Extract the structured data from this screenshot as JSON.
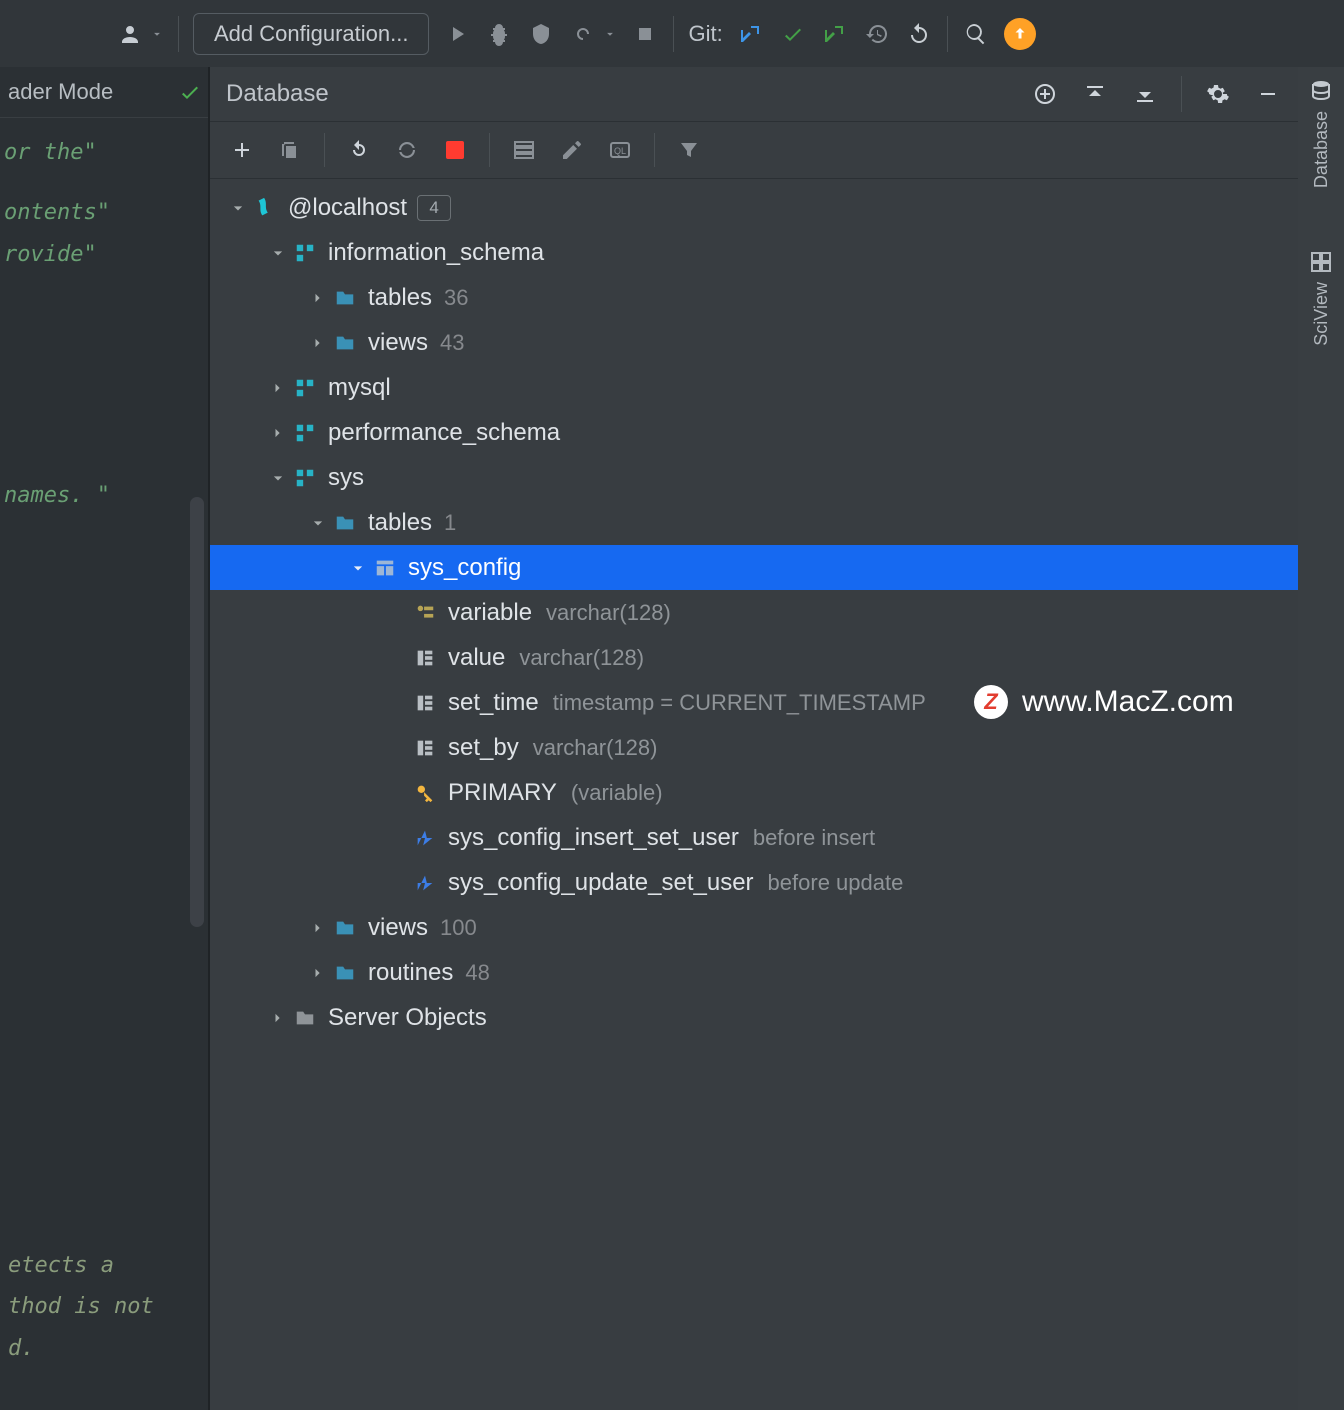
{
  "toolbar": {
    "config_label": "Add Configuration...",
    "git_label": "Git:"
  },
  "left": {
    "reader_mode": "ader Mode",
    "code": {
      "line1": "or the\"",
      "line2": "ontents\"",
      "line3": "rovide\"",
      "line4": " names. \"",
      "b1": "etects a",
      "b2": "thod is not",
      "b3": "d."
    }
  },
  "panel": {
    "title": "Database"
  },
  "rail": {
    "database": "Database",
    "sciview": "SciView"
  },
  "tree": {
    "host": {
      "label": "@localhost",
      "badge": "4"
    },
    "info_schema": "information_schema",
    "info_tables": {
      "label": "tables",
      "count": "36"
    },
    "info_views": {
      "label": "views",
      "count": "43"
    },
    "mysql": "mysql",
    "perf": "performance_schema",
    "sys": "sys",
    "sys_tables": {
      "label": "tables",
      "count": "1"
    },
    "sys_config": "sys_config",
    "col_variable": {
      "label": "variable",
      "type": "varchar(128)"
    },
    "col_value": {
      "label": "value",
      "type": "varchar(128)"
    },
    "col_settime": {
      "label": "set_time",
      "type": "timestamp = CURRENT_TIMESTAMP"
    },
    "col_setby": {
      "label": "set_by",
      "type": "varchar(128)"
    },
    "primary": {
      "label": "PRIMARY",
      "type": "(variable)"
    },
    "trig1": {
      "label": "sys_config_insert_set_user",
      "type": "before insert"
    },
    "trig2": {
      "label": "sys_config_update_set_user",
      "type": "before update"
    },
    "sys_views": {
      "label": "views",
      "count": "100"
    },
    "sys_routines": {
      "label": "routines",
      "count": "48"
    },
    "server_objects": "Server Objects"
  },
  "watermark": "www.MacZ.com"
}
